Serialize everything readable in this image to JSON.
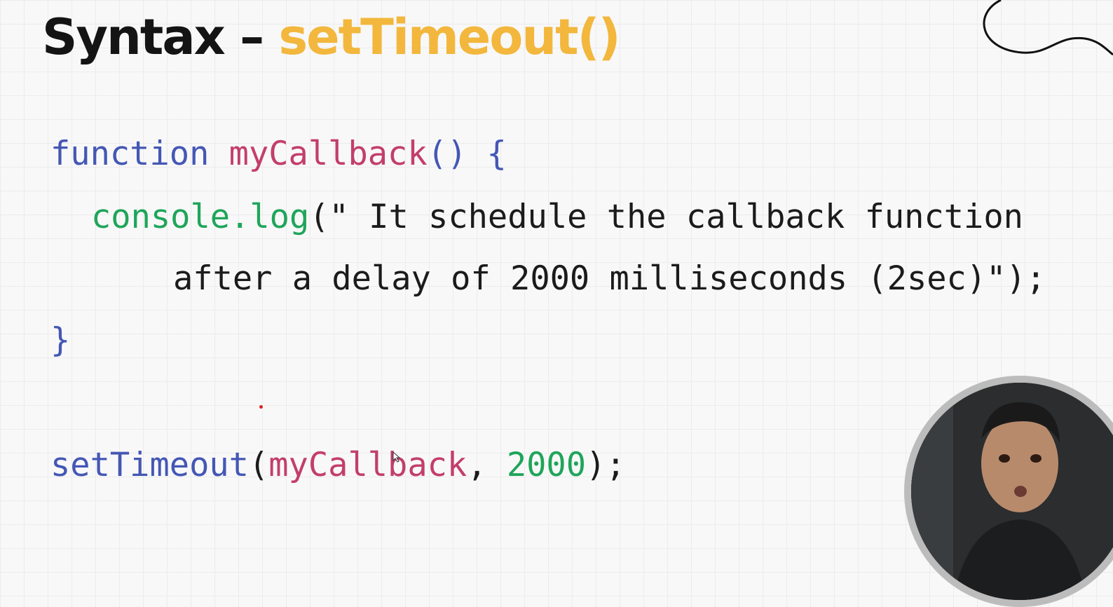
{
  "slide": {
    "title_main": "Syntax – ",
    "title_accent": "setTimeout()"
  },
  "code": {
    "line1": {
      "keyword": "function",
      "name": "myCallback",
      "rest": "() {"
    },
    "line2": {
      "object": "console.log",
      "text": "(\" It schedule the callback function"
    },
    "line3": {
      "text": "after a delay of 2000 milliseconds (2sec)\");"
    },
    "line4": {
      "text": "}"
    },
    "line5": {
      "call": "setTimeout",
      "open": "(",
      "arg1": "myCallback",
      "sep": ", ",
      "arg2": "2000",
      "close": ");"
    }
  },
  "colors": {
    "background": "#f8f8f8",
    "title_accent": "#f2b73c",
    "keyword_blue": "#4457b5",
    "function_name": "#c33e6a",
    "green": "#1fa55a"
  },
  "webcam": {
    "present": true
  }
}
